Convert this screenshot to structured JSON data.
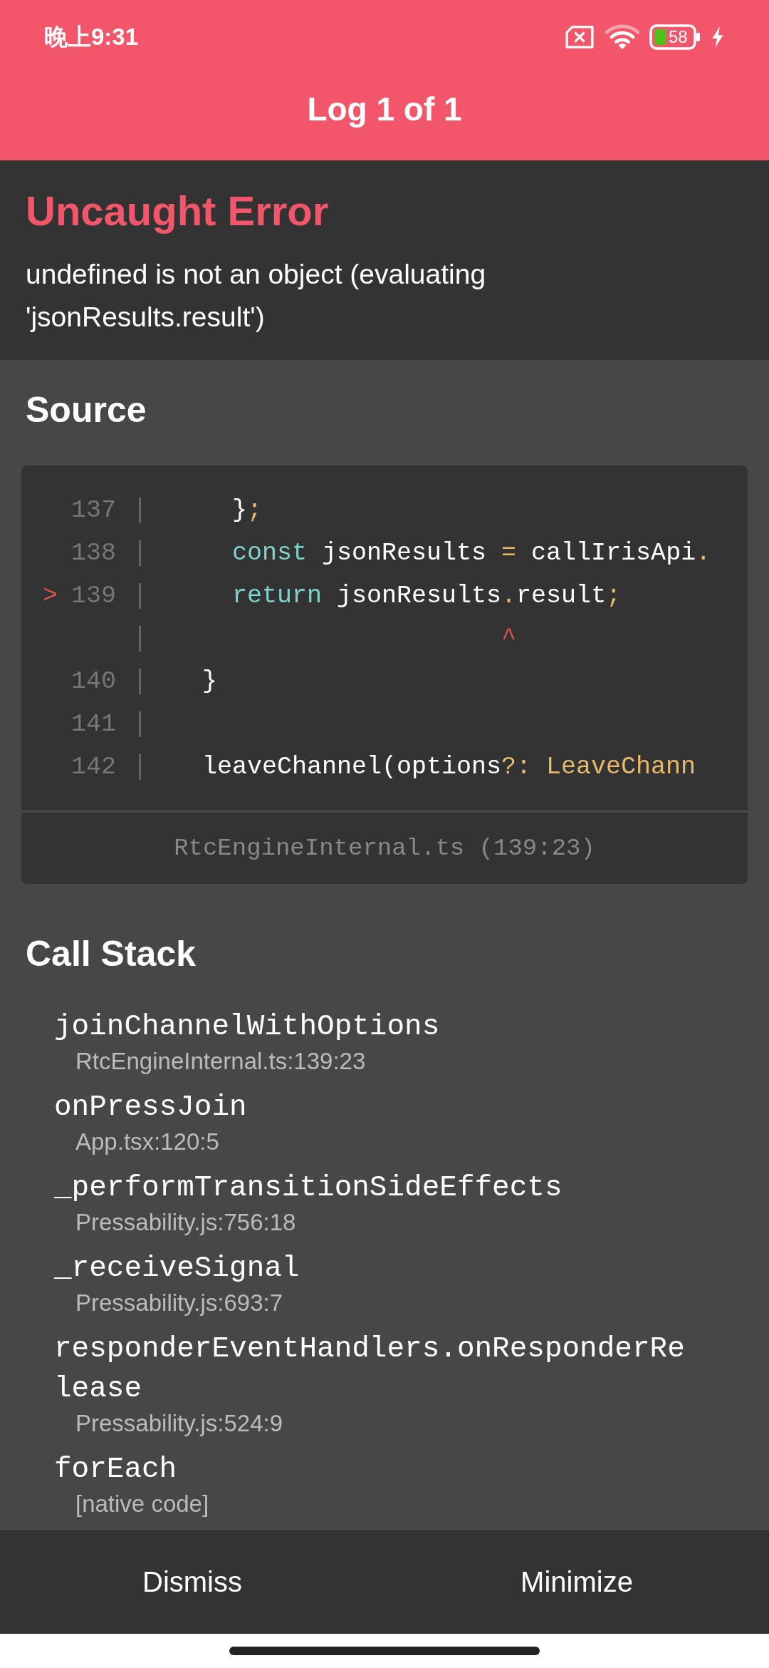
{
  "status_bar": {
    "time": "晚上9:31",
    "battery": "58"
  },
  "header": {
    "title": "Log 1 of 1"
  },
  "error": {
    "title": "Uncaught Error",
    "message": "undefined is not an object (evaluating 'jsonResults.result')"
  },
  "source": {
    "title": "Source",
    "lines": [
      {
        "number": "137",
        "tokens": [
          {
            "kind": "plain",
            "text": "    }"
          },
          {
            "kind": "punct",
            "text": ";"
          }
        ]
      },
      {
        "number": "138",
        "tokens": [
          {
            "kind": "keyword",
            "text": "    const"
          },
          {
            "kind": "plain",
            "text": " jsonResults "
          },
          {
            "kind": "punct",
            "text": "="
          },
          {
            "kind": "plain",
            "text": " callIrisApi"
          },
          {
            "kind": "punct",
            "text": "."
          }
        ]
      },
      {
        "marker": ">",
        "number": "139",
        "tokens": [
          {
            "kind": "keyword",
            "text": "    return"
          },
          {
            "kind": "plain",
            "text": " jsonResults"
          },
          {
            "kind": "punct",
            "text": "."
          },
          {
            "kind": "plain",
            "text": "result"
          },
          {
            "kind": "punct",
            "text": ";"
          }
        ]
      },
      {
        "tokens": [
          {
            "kind": "caret",
            "text": "                      ^"
          }
        ]
      },
      {
        "number": "140",
        "tokens": [
          {
            "kind": "plain",
            "text": "  }"
          }
        ]
      },
      {
        "number": "141"
      },
      {
        "number": "142",
        "tokens": [
          {
            "kind": "plain",
            "text": "  leaveChannel(options"
          },
          {
            "kind": "punct",
            "text": "?: "
          },
          {
            "kind": "type",
            "text": "LeaveChann"
          }
        ]
      }
    ],
    "location": "RtcEngineInternal.ts (139:23)"
  },
  "call_stack": {
    "title": "Call Stack",
    "frames": [
      {
        "name": "joinChannelWithOptions",
        "file": "RtcEngineInternal.ts:139:23"
      },
      {
        "name": "onPressJoin",
        "file": "App.tsx:120:5"
      },
      {
        "name": "_performTransitionSideEffects",
        "file": "Pressability.js:756:18"
      },
      {
        "name": "_receiveSignal",
        "file": "Pressability.js:693:7"
      },
      {
        "name": "responderEventHandlers.onResponderRelease",
        "file": "Pressability.js:524:9"
      },
      {
        "name": "forEach",
        "file": "[native code]"
      }
    ]
  },
  "buttons": [
    "Dismiss",
    "Minimize"
  ]
}
